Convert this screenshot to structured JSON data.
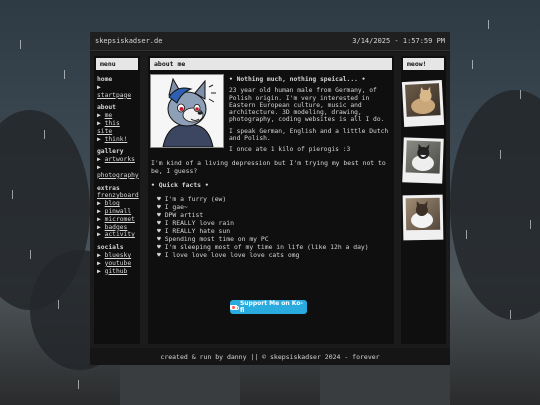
{
  "titlebar": {
    "site_name": "skepsiskadser.de",
    "datetime": "3/14/2025 - 1:57:59 PM"
  },
  "menu": {
    "title": "menu",
    "sections": [
      {
        "heading": "home",
        "items": [
          "startpage"
        ]
      },
      {
        "heading": "about",
        "items": [
          "me",
          "this site",
          "think!"
        ]
      },
      {
        "heading": "gallery",
        "items": [
          "artworks",
          "photography"
        ]
      },
      {
        "heading": "extras",
        "items": [
          "frenzyboard",
          "blog",
          "pinwall",
          "micromet",
          "badges",
          "activity"
        ]
      },
      {
        "heading": "socials",
        "items": [
          "bluesky",
          "youtube",
          "github"
        ]
      }
    ]
  },
  "about": {
    "title": "about me",
    "headline": "• Nothing much, nothing speical... •",
    "paragraphs": [
      "23 year old human male from Germany, of Polish origin. I'm very interested in Eastern European culture, music and architecture. 3D modeling, drawing, photography, coding websites is all I do.",
      "I speak German, English and a little Dutch and Polish.",
      "I once ate 1 kilo of pierogis :3"
    ],
    "intro": "I'm kind of a living depression but I'm trying my best not to be, I guess?",
    "facts_title": "• Quick facts •",
    "facts": [
      "♥ I'm a furry (ew)",
      "♥ I gae~",
      "♥ DPW artist",
      "♥ I REALLY love rain",
      "♥ I REALLY hate sun",
      "♥ Spending most time on my PC",
      "♥ I'm sleeping most of my time in life (like 12h a day)",
      "♥ I love love love love love cats omg"
    ],
    "kofi_label": "Support Me on Ko-fi"
  },
  "sidebar_right": {
    "title": "meow!"
  },
  "footer": {
    "prefix": "created & run by ",
    "author": "danny",
    "suffix": " || © skepsiskadser 2024 - forever"
  },
  "colors": {
    "accent": "#29abe0",
    "panel": "#0f0f0f",
    "header": "#e6e6e6"
  }
}
